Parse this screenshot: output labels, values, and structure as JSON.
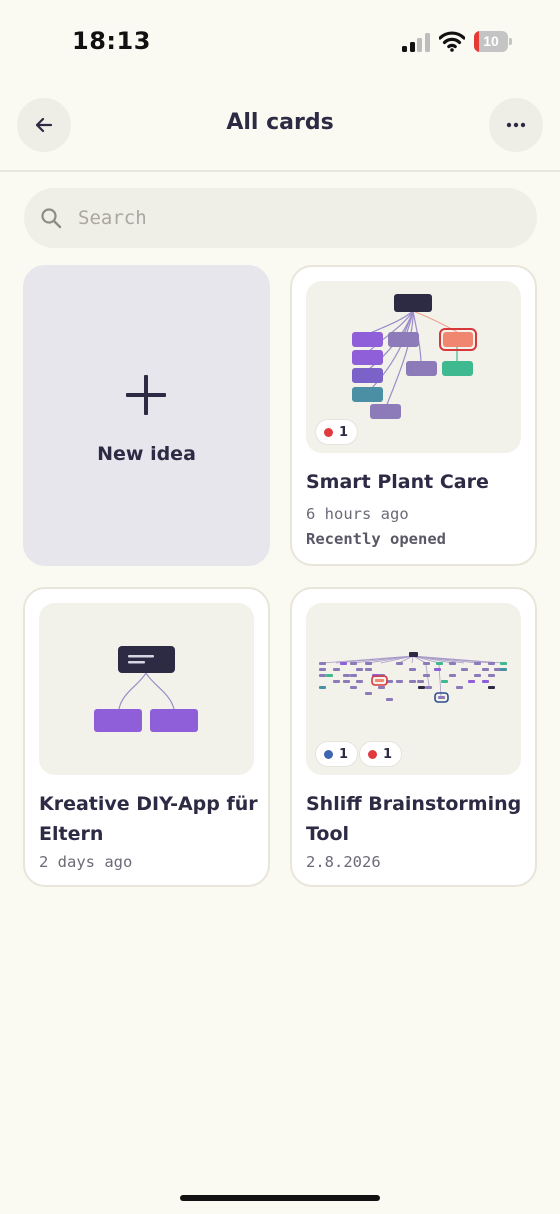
{
  "status_bar": {
    "time": "18:13",
    "battery_level": "10"
  },
  "header": {
    "title": "All cards"
  },
  "search": {
    "placeholder": "Search"
  },
  "new_idea": {
    "label": "New idea"
  },
  "cards": [
    {
      "title": "Smart Plant Care",
      "time": "6 hours ago",
      "status": "Recently opened",
      "badges": [
        {
          "color": "#e0393e",
          "count": "1"
        }
      ]
    },
    {
      "title": "Kreative DIY-App für Eltern",
      "time": "2 days ago"
    },
    {
      "title": "Shliff Brainstorming Tool",
      "time": "2.8.2026",
      "badges": [
        {
          "color": "#3f64b0",
          "count": "1"
        },
        {
          "color": "#e0393e",
          "count": "1"
        }
      ]
    }
  ],
  "colors": {
    "background": "#faf9f2",
    "ink": "#2d2a44",
    "purple": "#8f5fd9",
    "lavender": "#8c7bb8",
    "coral": "#f08570",
    "green": "#3fb98f",
    "teal": "#4a8fa3"
  }
}
